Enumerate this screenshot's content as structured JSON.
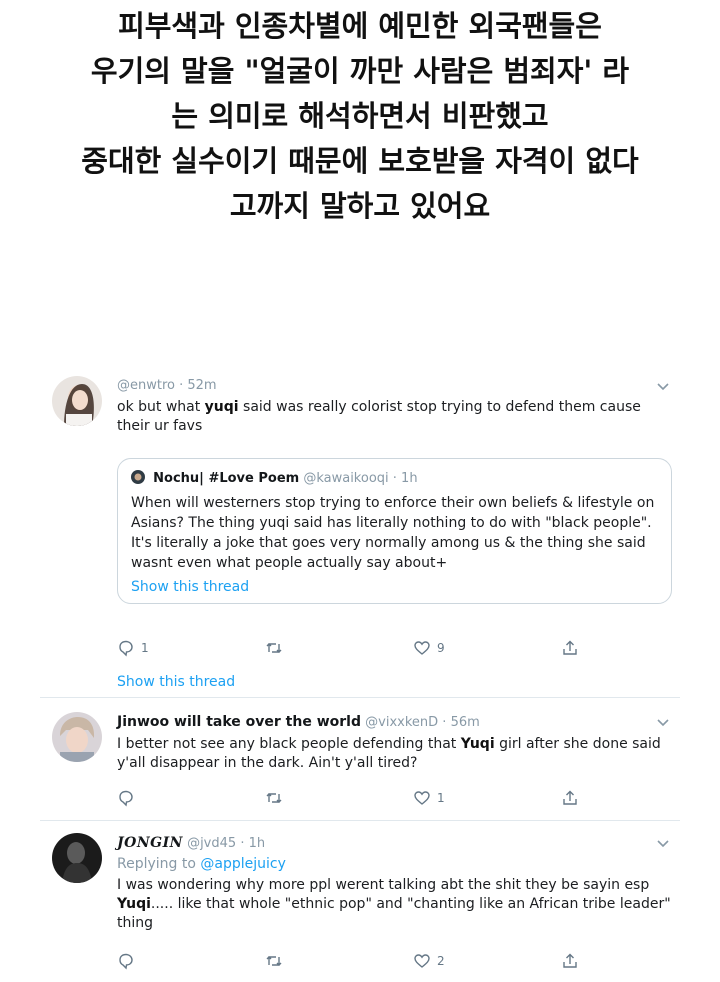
{
  "caption": {
    "lines": [
      "피부색과 인종차별에 예민한 외국팬들은",
      "우기의 말을 \"얼굴이 까만 사람은 범죄자' 라",
      "는 의미로 해석하면서 비판했고",
      "중대한 실수이기 때문에 보호받을 자격이 없다",
      "고까지 말하고 있어요"
    ]
  },
  "tweets": [
    {
      "handle": "@enwtro",
      "time": "52m",
      "text_before": "ok but what ",
      "text_bold": "yuqi",
      "text_after": " said was really colorist stop trying to defend them cause their ur favs",
      "quote": {
        "name": "Nochu| #Love Poem",
        "handle": "@kawaikooqi",
        "time": "1h",
        "text": "When will westerners stop trying to enforce their own beliefs & lifestyle on Asians? The thing yuqi said has literally nothing to do with \"black people\". It's literally a joke that goes very normally among us & the thing she said wasnt even what people actually say about+",
        "show_thread": "Show this thread"
      },
      "replies": "1",
      "retweets": "",
      "likes": "9",
      "show_thread": "Show this thread"
    },
    {
      "name": "Jinwoo will take over the world",
      "handle": "@vixxkenD",
      "time": "56m",
      "text_before": "I better not see any black people defending that ",
      "text_bold": "Yuqi",
      "text_after": " girl after she done said y'all disappear in the dark. Ain't y'all tired?",
      "replies": "",
      "retweets": "",
      "likes": "1"
    },
    {
      "name": "JONGIN",
      "handle": "@jvd45",
      "time": "1h",
      "replying_label": "Replying to ",
      "replying_to": "@applejuicy",
      "text_before": "I was wondering why more ppl werent talking abt the shit they be sayin esp ",
      "text_bold": "Yuqi",
      "text_after": "..... like that whole \"ethnic pop\" and \"chanting like an African tribe leader\" thing",
      "replies": "",
      "retweets": "",
      "likes": "2"
    }
  ],
  "colors": {
    "link": "#1da1f2",
    "muted": "#8899a6",
    "divider": "#e1e8ed"
  },
  "icons": [
    "reply-icon",
    "retweet-icon",
    "like-icon",
    "share-icon",
    "chevron-down-icon"
  ]
}
